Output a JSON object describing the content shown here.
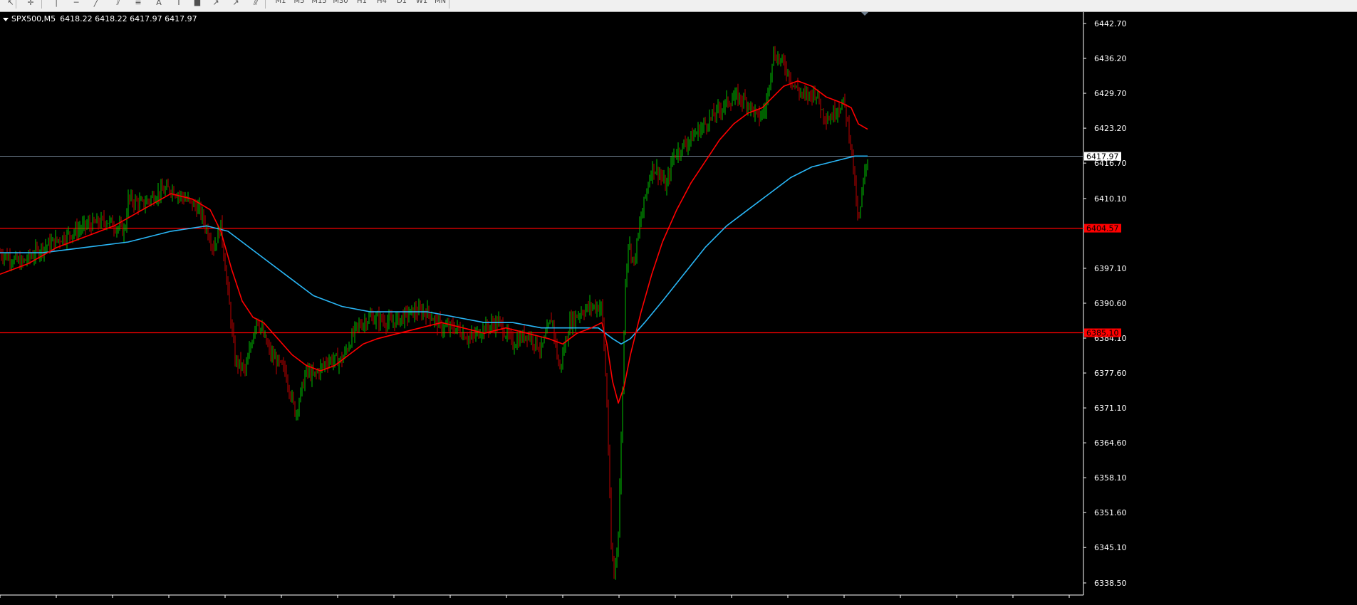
{
  "toolbar": {
    "tools": [
      {
        "name": "cursor-tool",
        "glyph": "↖"
      },
      {
        "name": "crosshair-tool",
        "glyph": "✛"
      },
      {
        "name": "vertical-line-tool",
        "glyph": "│"
      },
      {
        "name": "horizontal-line-tool",
        "glyph": "─"
      },
      {
        "name": "trendline-tool",
        "glyph": "╱"
      },
      {
        "name": "equidistant-channel-tool",
        "glyph": "⫽"
      },
      {
        "name": "fibonacci-retracement-tool",
        "glyph": "≡"
      },
      {
        "name": "text-tool",
        "glyph": "A"
      },
      {
        "name": "text-label-tool",
        "glyph": "T"
      },
      {
        "name": "shapes-tool",
        "glyph": "■"
      },
      {
        "name": "arrows-tool",
        "glyph": "↗"
      },
      {
        "name": "gann-fan-tool",
        "glyph": "↗"
      },
      {
        "name": "fibonacci-fan-tool",
        "glyph": "⫻"
      }
    ],
    "timeframes": [
      "M1",
      "M5",
      "M15",
      "M30",
      "H1",
      "H4",
      "D1",
      "W1",
      "MN"
    ]
  },
  "chart": {
    "symbol": "SPX500,M5",
    "open": "6418.22",
    "high": "6418.22",
    "low": "6417.97",
    "close": "6417.97",
    "price_axis": [
      "6442.70",
      "6436.20",
      "6429.70",
      "6423.20",
      "6416.70",
      "6410.10",
      "6397.10",
      "6390.60",
      "6384.10",
      "6377.60",
      "6371.10",
      "6364.60",
      "6358.10",
      "6351.60",
      "6345.10",
      "6338.50"
    ],
    "current_price_label": "6417.97",
    "hline_labels": [
      "6404.57",
      "6385.10"
    ],
    "colors": {
      "background": "#000000",
      "bull": "#00c000",
      "bear": "#c00000",
      "ma_fast": "#ff0000",
      "ma_slow": "#29b6f6",
      "hline": "#ff0000",
      "bid_line": "#708090",
      "axis": "#ffffff"
    },
    "chart_data": {
      "type": "candlestick",
      "ylim": [
        6336.5,
        6444.5
      ],
      "price_series": [
        [
          0,
          6400
        ],
        [
          30,
          6398
        ],
        [
          60,
          6401
        ],
        [
          90,
          6403
        ],
        [
          120,
          6405
        ],
        [
          150,
          6406
        ],
        [
          175,
          6404
        ],
        [
          180,
          6410
        ],
        [
          200,
          6409
        ],
        [
          220,
          6411
        ],
        [
          240,
          6412
        ],
        [
          260,
          6410
        ],
        [
          280,
          6408
        ],
        [
          300,
          6401
        ],
        [
          310,
          6405
        ],
        [
          330,
          6380
        ],
        [
          345,
          6378
        ],
        [
          360,
          6388
        ],
        [
          380,
          6381
        ],
        [
          400,
          6378
        ],
        [
          415,
          6370
        ],
        [
          430,
          6378
        ],
        [
          440,
          6377
        ],
        [
          460,
          6380
        ],
        [
          480,
          6380
        ],
        [
          500,
          6386
        ],
        [
          520,
          6388
        ],
        [
          550,
          6387
        ],
        [
          580,
          6389
        ],
        [
          600,
          6389
        ],
        [
          620,
          6386
        ],
        [
          640,
          6386
        ],
        [
          660,
          6384
        ],
        [
          680,
          6386
        ],
        [
          700,
          6387
        ],
        [
          720,
          6383
        ],
        [
          740,
          6385
        ],
        [
          760,
          6382
        ],
        [
          775,
          6388
        ],
        [
          785,
          6378
        ],
        [
          800,
          6387
        ],
        [
          815,
          6389
        ],
        [
          830,
          6390
        ],
        [
          845,
          6390
        ],
        [
          852,
          6372
        ],
        [
          858,
          6345
        ],
        [
          862,
          6340
        ],
        [
          868,
          6348
        ],
        [
          872,
          6365
        ],
        [
          878,
          6395
        ],
        [
          882,
          6402
        ],
        [
          890,
          6398
        ],
        [
          898,
          6405
        ],
        [
          905,
          6410
        ],
        [
          915,
          6416
        ],
        [
          925,
          6415
        ],
        [
          935,
          6412
        ],
        [
          945,
          6418
        ],
        [
          960,
          6420
        ],
        [
          975,
          6422
        ],
        [
          990,
          6424
        ],
        [
          1005,
          6426
        ],
        [
          1020,
          6428
        ],
        [
          1035,
          6429
        ],
        [
          1050,
          6428
        ],
        [
          1065,
          6425
        ],
        [
          1075,
          6427
        ],
        [
          1085,
          6437
        ],
        [
          1095,
          6436
        ],
        [
          1105,
          6434
        ],
        [
          1115,
          6431
        ],
        [
          1130,
          6429
        ],
        [
          1145,
          6430
        ],
        [
          1155,
          6426
        ],
        [
          1165,
          6425
        ],
        [
          1175,
          6427
        ],
        [
          1185,
          6428
        ],
        [
          1195,
          6420
        ],
        [
          1205,
          6405
        ],
        [
          1212,
          6413
        ],
        [
          1218,
          6418
        ]
      ],
      "ma_fast": [
        [
          0,
          6396
        ],
        [
          40,
          6398
        ],
        [
          80,
          6401
        ],
        [
          120,
          6403
        ],
        [
          160,
          6405
        ],
        [
          200,
          6408
        ],
        [
          240,
          6411
        ],
        [
          270,
          6410
        ],
        [
          295,
          6408
        ],
        [
          310,
          6404
        ],
        [
          325,
          6397
        ],
        [
          340,
          6391
        ],
        [
          355,
          6388
        ],
        [
          370,
          6387
        ],
        [
          390,
          6384
        ],
        [
          410,
          6381
        ],
        [
          430,
          6379
        ],
        [
          450,
          6378
        ],
        [
          470,
          6379
        ],
        [
          490,
          6381
        ],
        [
          510,
          6383
        ],
        [
          530,
          6384
        ],
        [
          560,
          6385
        ],
        [
          590,
          6386
        ],
        [
          620,
          6387
        ],
        [
          650,
          6386
        ],
        [
          680,
          6385
        ],
        [
          710,
          6386
        ],
        [
          740,
          6385
        ],
        [
          770,
          6384
        ],
        [
          790,
          6383
        ],
        [
          810,
          6385
        ],
        [
          830,
          6386
        ],
        [
          845,
          6387
        ],
        [
          852,
          6383
        ],
        [
          860,
          6376
        ],
        [
          868,
          6372
        ],
        [
          876,
          6375
        ],
        [
          885,
          6381
        ],
        [
          900,
          6389
        ],
        [
          915,
          6396
        ],
        [
          930,
          6402
        ],
        [
          950,
          6408
        ],
        [
          970,
          6413
        ],
        [
          990,
          6417
        ],
        [
          1010,
          6421
        ],
        [
          1030,
          6424
        ],
        [
          1050,
          6426
        ],
        [
          1070,
          6427
        ],
        [
          1085,
          6429
        ],
        [
          1100,
          6431
        ],
        [
          1120,
          6432
        ],
        [
          1140,
          6431
        ],
        [
          1160,
          6429
        ],
        [
          1180,
          6428
        ],
        [
          1195,
          6427
        ],
        [
          1205,
          6424
        ],
        [
          1218,
          6423
        ]
      ],
      "ma_slow": [
        [
          0,
          6400
        ],
        [
          60,
          6400
        ],
        [
          120,
          6401
        ],
        [
          180,
          6402
        ],
        [
          240,
          6404
        ],
        [
          290,
          6405
        ],
        [
          320,
          6404
        ],
        [
          360,
          6400
        ],
        [
          400,
          6396
        ],
        [
          440,
          6392
        ],
        [
          480,
          6390
        ],
        [
          520,
          6389
        ],
        [
          560,
          6389
        ],
        [
          600,
          6389
        ],
        [
          640,
          6388
        ],
        [
          680,
          6387
        ],
        [
          720,
          6387
        ],
        [
          760,
          6386
        ],
        [
          800,
          6386
        ],
        [
          840,
          6386
        ],
        [
          860,
          6384
        ],
        [
          872,
          6383
        ],
        [
          885,
          6384
        ],
        [
          905,
          6387
        ],
        [
          930,
          6391
        ],
        [
          960,
          6396
        ],
        [
          990,
          6401
        ],
        [
          1020,
          6405
        ],
        [
          1050,
          6408
        ],
        [
          1080,
          6411
        ],
        [
          1110,
          6414
        ],
        [
          1140,
          6416
        ],
        [
          1170,
          6417
        ],
        [
          1200,
          6418
        ],
        [
          1218,
          6418
        ]
      ]
    }
  }
}
